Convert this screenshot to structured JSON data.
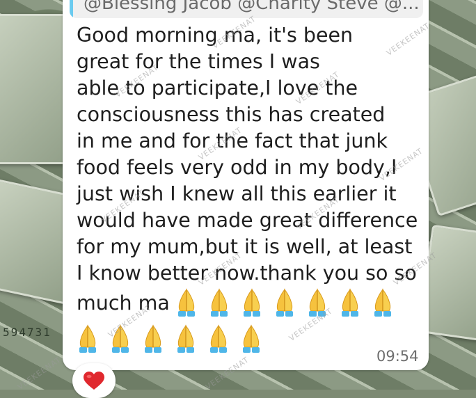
{
  "quoted_reply": {
    "text": "@Blessing Jacob @Charity Steve @...",
    "accent_color": "#6bcbef"
  },
  "message": {
    "text": "Good morning ma, it's been\ngreat for the times I was\nable to participate,I love the\nconsciousness this has created\nin me and for the fact that junk\nfood feels very odd in my body,I\njust wish I knew all this earlier it\nwould have made great difference\nfor my mum,but it is well, at least\nI know better now.thank you so so",
    "last_line_text": "much ma",
    "emoji_icon": "folded-hands-emoji",
    "emoji_count_line1": 7,
    "emoji_count_line2": 6
  },
  "timestamp": "09:54",
  "reaction": {
    "icon": "red-heart-emoji",
    "color": "#e0282e"
  },
  "watermark": "VEEKEENAT",
  "background": {
    "serial_text": "594731"
  }
}
